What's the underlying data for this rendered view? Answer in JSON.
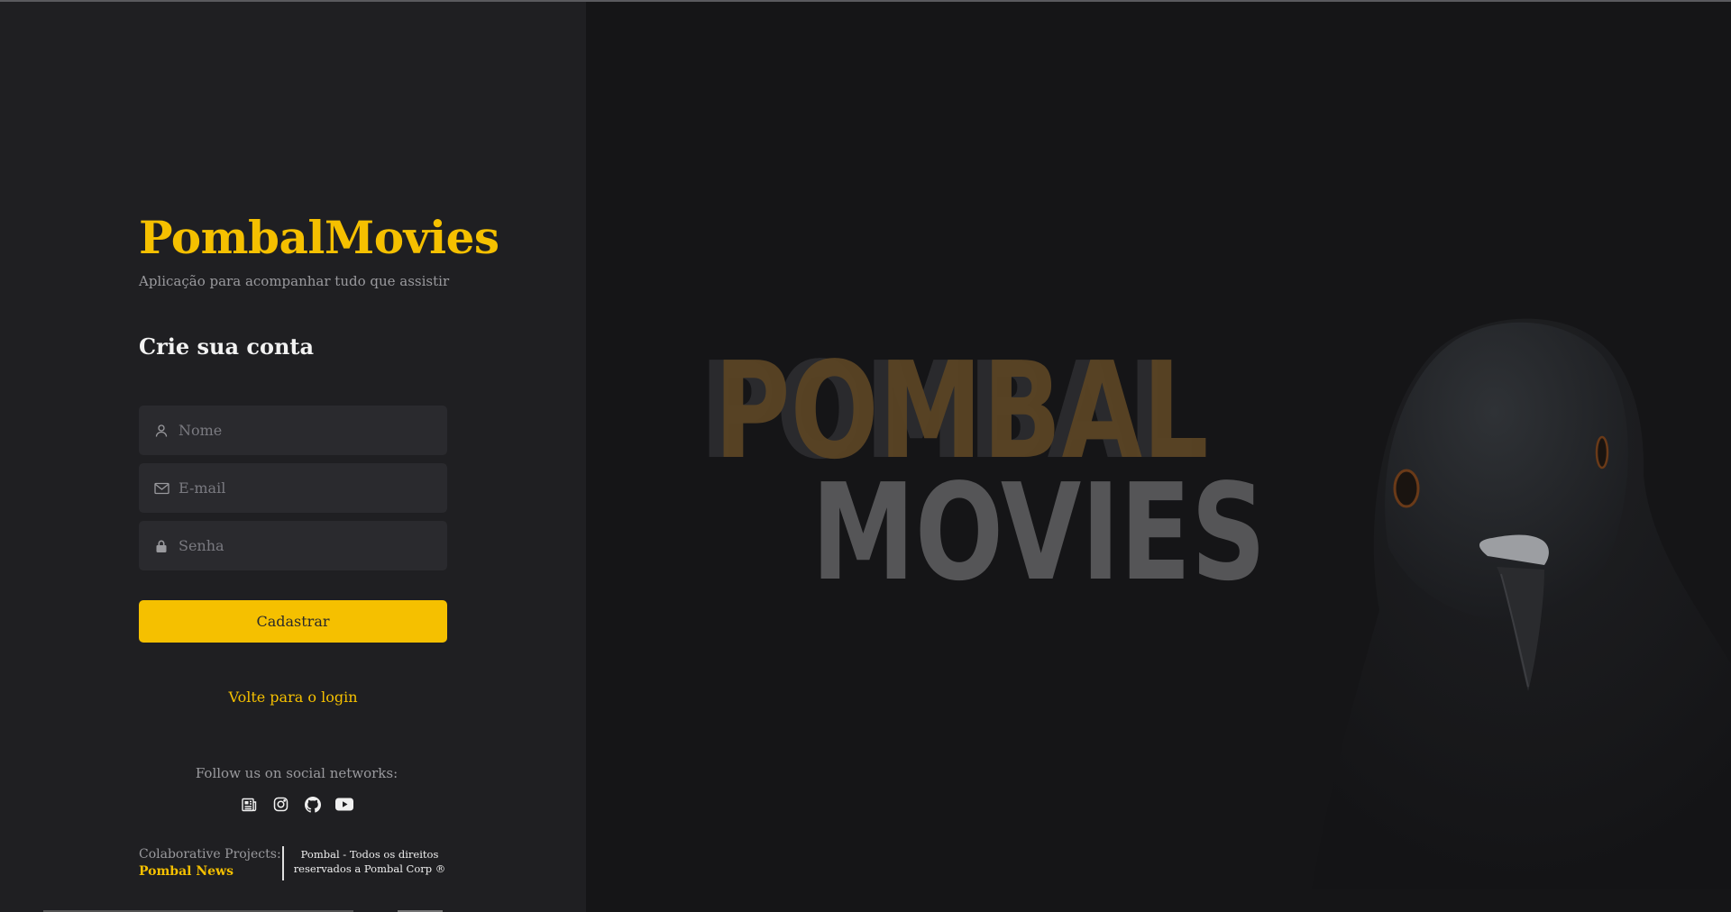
{
  "app": {
    "title": "PombalMovies",
    "subtitle": "Aplicação para acompanhar tudo que assistir"
  },
  "form": {
    "title": "Crie sua conta",
    "fields": {
      "name": {
        "placeholder": "Nome",
        "value": "",
        "icon": "user-icon"
      },
      "email": {
        "placeholder": "E-mail",
        "value": "",
        "icon": "mail-icon"
      },
      "password": {
        "placeholder": "Senha",
        "value": "",
        "icon": "lock-icon"
      }
    },
    "submit_label": "Cadastrar",
    "back_link": "Volte para o login"
  },
  "footer": {
    "follow_text": "Follow us on social networks:",
    "social_icons": [
      "news-icon",
      "instagram-icon",
      "github-icon",
      "youtube-icon"
    ],
    "collab_label": "Colaborative Projects:",
    "collab_link": "Pombal News",
    "copyright": "Pombal - Todos os direitos reservados a Pombal Corp ®"
  },
  "hero": {
    "line1": "POMBAL",
    "line2": "MOVIES"
  },
  "colors": {
    "accent": "#f5c000",
    "panel": "#1f1f22",
    "background": "#151517",
    "input": "#2a2a2e"
  }
}
